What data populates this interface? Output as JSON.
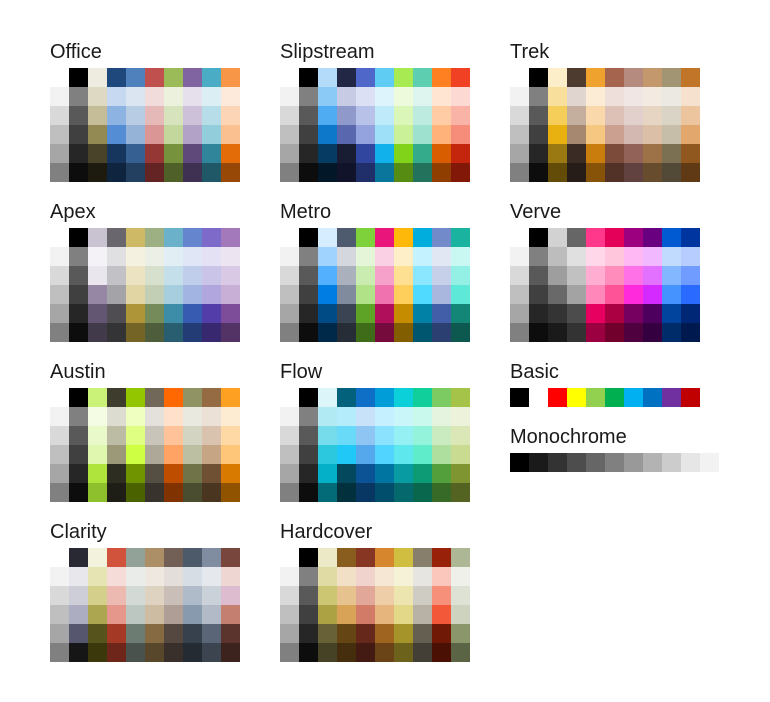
{
  "columns": [
    {
      "palettes": [
        {
          "name": "Office",
          "rows": [
            [
              "#ffffff",
              "#000000",
              "#eeece1",
              "#1f497d",
              "#4f81bd",
              "#c0504d",
              "#9bbb59",
              "#8064a2",
              "#4bacc6",
              "#f79646"
            ],
            [
              "#f2f2f2",
              "#808080",
              "#ddd9c3",
              "#c6d9f0",
              "#dbe5f1",
              "#f2dcdb",
              "#ebf1dd",
              "#e5e0ec",
              "#dbeef3",
              "#fdeada"
            ],
            [
              "#d9d9d9",
              "#595959",
              "#c4bd97",
              "#8db3e2",
              "#b8cce4",
              "#e5b9b7",
              "#d7e3bc",
              "#ccc1d9",
              "#b7dde8",
              "#fbd5b5"
            ],
            [
              "#bfbfbf",
              "#404040",
              "#938953",
              "#548dd4",
              "#95b3d7",
              "#d99694",
              "#c3d69b",
              "#b2a2c7",
              "#92cddc",
              "#fac08f"
            ],
            [
              "#a6a6a6",
              "#262626",
              "#494429",
              "#17365d",
              "#366092",
              "#953734",
              "#76923c",
              "#5f497a",
              "#31859b",
              "#e36c09"
            ],
            [
              "#808080",
              "#0d0d0d",
              "#1d1b10",
              "#0f243e",
              "#244061",
              "#632423",
              "#4f6128",
              "#3f3151",
              "#205867",
              "#974806"
            ]
          ]
        },
        {
          "name": "Apex",
          "rows": [
            [
              "#ffffff",
              "#000000",
              "#c9c2d1",
              "#69676d",
              "#ceb966",
              "#9cb084",
              "#6bb1c9",
              "#6585cf",
              "#7e6bc9",
              "#a379bb"
            ],
            [
              "#f2f2f2",
              "#808080",
              "#f4f2f6",
              "#e0e0e2",
              "#f5f1e0",
              "#ebefe6",
              "#e1eff4",
              "#e0e6f5",
              "#e5e1f4",
              "#ece4f1"
            ],
            [
              "#d9d9d9",
              "#595959",
              "#e9e6ed",
              "#c2c1c5",
              "#ebe3c1",
              "#d7dfcd",
              "#c4dfe9",
              "#c1ceeb",
              "#cbc4e9",
              "#d9c9e4"
            ],
            [
              "#bfbfbf",
              "#404040",
              "#9688a5",
              "#a4a3a8",
              "#e1d5a3",
              "#c3cfb4",
              "#a6cedf",
              "#a2b5e2",
              "#b1a6de",
              "#c7afd6"
            ],
            [
              "#a6a6a6",
              "#262626",
              "#635672",
              "#4f4d52",
              "#ae9638",
              "#758c5a",
              "#3d8da9",
              "#365bb0",
              "#533da9",
              "#7d4d99"
            ],
            [
              "#808080",
              "#0d0d0d",
              "#413a4b",
              "#343336",
              "#746425",
              "#4e5d3c",
              "#285e70",
              "#243c75",
              "#372870",
              "#533366"
            ]
          ]
        },
        {
          "name": "Austin",
          "rows": [
            [
              "#ffffff",
              "#000000",
              "#caf278",
              "#3e3d2d",
              "#94c600",
              "#71685a",
              "#ff6700",
              "#909465",
              "#956b43",
              "#fea022"
            ],
            [
              "#f2f2f2",
              "#808080",
              "#f4fce4",
              "#dddcd0",
              "#efffc0",
              "#e4e1dc",
              "#ffe0cb",
              "#e9e9e0",
              "#ece1d6",
              "#feecd2"
            ],
            [
              "#d9d9d9",
              "#595959",
              "#eaf9c9",
              "#bcbba3",
              "#dfff82",
              "#c9c4ba",
              "#ffc299",
              "#d3d4c1",
              "#d9c3ae",
              "#fed9a6"
            ],
            [
              "#bfbfbf",
              "#404040",
              "#dff7ae",
              "#9b9977",
              "#ceff43",
              "#aea898",
              "#ffa365",
              "#bdbfa2",
              "#c6a585",
              "#fec679"
            ],
            [
              "#a6a6a6",
              "#262626",
              "#aee43c",
              "#2e2d21",
              "#6f9400",
              "#544e43",
              "#bf4d00",
              "#6f7347",
              "#6f5032",
              "#d97a00"
            ],
            [
              "#808080",
              "#0d0d0d",
              "#8ec02d",
              "#1f1e16",
              "#4a6300",
              "#38342d",
              "#803300",
              "#4a4d2f",
              "#4a3521",
              "#905300"
            ]
          ]
        },
        {
          "name": "Clarity",
          "rows": [
            [
              "#ffffff",
              "#292934",
              "#f3f2dc",
              "#d2533c",
              "#93a299",
              "#ad8f67",
              "#726056",
              "#4c5a6a",
              "#808da0",
              "#79463d"
            ],
            [
              "#f2f2f2",
              "#e7e7ec",
              "#e6e4b3",
              "#f6dcd8",
              "#e9ece9",
              "#eee8e0",
              "#e4dedb",
              "#d7dde4",
              "#e5e8ec",
              "#eed6d2"
            ],
            [
              "#d9d9d9",
              "#ceced9",
              "#d4d08c",
              "#edbab1",
              "#d3d9d5",
              "#ded2c1",
              "#c9beb8",
              "#b0bbc9",
              "#cbd1d8",
              "#debccf"
            ],
            [
              "#bfbfbf",
              "#adadc1",
              "#aca651",
              "#e4978a",
              "#bdc7c1",
              "#cdbba2",
              "#ae9e95",
              "#889aae",
              "#b2bac7",
              "#c57f71"
            ],
            [
              "#a6a6a6",
              "#56566e",
              "#56531d",
              "#a43925",
              "#6d7c73",
              "#866b42",
              "#554840",
              "#37414d",
              "#5a6678",
              "#5a342d"
            ],
            [
              "#808080",
              "#161616",
              "#3b390c",
              "#6d2619",
              "#49524d",
              "#59472c",
              "#39302b",
              "#242b33",
              "#3c4450",
              "#3c231e"
            ]
          ]
        }
      ]
    },
    {
      "palettes": [
        {
          "name": "Slipstream",
          "rows": [
            [
              "#ffffff",
              "#000000",
              "#b4dcfa",
              "#212745",
              "#4e67c8",
              "#5eccf3",
              "#a7ea52",
              "#5dceaf",
              "#ff8021",
              "#f14124"
            ],
            [
              "#f2f2f2",
              "#808080",
              "#8bc9f7",
              "#c7cce4",
              "#dbe0f4",
              "#def4fc",
              "#edfadc",
              "#def5ef",
              "#ffe5d2",
              "#fcd9d3"
            ],
            [
              "#d9d9d9",
              "#595959",
              "#4facf3",
              "#909aca",
              "#b8c2e9",
              "#beeafa",
              "#dbf6b9",
              "#bdebdf",
              "#ffcca6",
              "#f9b3a7"
            ],
            [
              "#bfbfbf",
              "#404040",
              "#0d78c9",
              "#5967af",
              "#94a3de",
              "#9ee0f7",
              "#cAf197",
              "#9ee1cf",
              "#ffb279",
              "#f68d7b"
            ],
            [
              "#a6a6a6",
              "#262626",
              "#063c64",
              "#181d33",
              "#31479f",
              "#11b2eb",
              "#81d319",
              "#34ac8b",
              "#d85c00",
              "#c3260c"
            ],
            [
              "#808080",
              "#0d0d0d",
              "#021828",
              "#10132a",
              "#202f6a",
              "#0b769c",
              "#568c11",
              "#22725c",
              "#903d00",
              "#821908"
            ]
          ]
        },
        {
          "name": "Metro",
          "rows": [
            [
              "#ffffff",
              "#000000",
              "#d6ecff",
              "#4e5b6f",
              "#7fd13b",
              "#ea157a",
              "#feb80a",
              "#00addc",
              "#738aca",
              "#1ab39f"
            ],
            [
              "#f2f2f2",
              "#808080",
              "#a1d3ff",
              "#d4d8de",
              "#e5f5d7",
              "#fad0e4",
              "#feefc8",
              "#c5f2ff",
              "#e2e7f4",
              "#c9f7f2"
            ],
            [
              "#d9d9d9",
              "#595959",
              "#52b0ff",
              "#aab1bd",
              "#cbecb0",
              "#f5a1c9",
              "#fee092",
              "#8be6ff",
              "#c6d0e9",
              "#94f0e5"
            ],
            [
              "#bfbfbf",
              "#404040",
              "#007de2",
              "#808b9d",
              "#b1e288",
              "#f072ae",
              "#fed05b",
              "#51daff",
              "#a9b7de",
              "#5ee8d8"
            ],
            [
              "#a6a6a6",
              "#262626",
              "#004a86",
              "#3a4453",
              "#5ea226",
              "#af0f5b",
              "#c58c00",
              "#0081a5",
              "#425ea9",
              "#138677"
            ],
            [
              "#808080",
              "#0d0d0d",
              "#002848",
              "#272d37",
              "#3f6c19",
              "#750a3d",
              "#835e00",
              "#00566e",
              "#2c3f71",
              "#0d594f"
            ]
          ]
        },
        {
          "name": "Flow",
          "rows": [
            [
              "#ffffff",
              "#000000",
              "#dbf5f9",
              "#04617b",
              "#0f6fc6",
              "#009dd9",
              "#0bd0d9",
              "#10cf9b",
              "#7cca62",
              "#a5c249"
            ],
            [
              "#f2f2f2",
              "#808080",
              "#b2eaf3",
              "#b4ecfc",
              "#c7e2f9",
              "#c5f0ff",
              "#c9f7f9",
              "#c9f9ed",
              "#e4f4df",
              "#edf3da"
            ],
            [
              "#d9d9d9",
              "#595959",
              "#76dceb",
              "#6adaf9",
              "#8ec5f3",
              "#8be2ff",
              "#94f0f3",
              "#93f3db",
              "#caeabf",
              "#dbe7b6"
            ],
            [
              "#bfbfbf",
              "#404040",
              "#2bc8de",
              "#20c8f7",
              "#56a8ed",
              "#51d4ff",
              "#5ee8ee",
              "#5eecca",
              "#afdf9f",
              "#c9db91"
            ],
            [
              "#a6a6a6",
              "#262626",
              "#04b0c7",
              "#03485c",
              "#0b5394",
              "#0075a2",
              "#089ca2",
              "#0c9b74",
              "#539f3b",
              "#7e9532"
            ],
            [
              "#808080",
              "#0d0d0d",
              "#036a78",
              "#02303d",
              "#083763",
              "#004e6c",
              "#05686c",
              "#08674d",
              "#376a27",
              "#546321"
            ]
          ]
        },
        {
          "name": "Hardcover",
          "rows": [
            [
              "#ffffff",
              "#000000",
              "#ece9c6",
              "#895d1d",
              "#873624",
              "#d6862d",
              "#d0be40",
              "#877f6c",
              "#972109",
              "#aeb795"
            ],
            [
              "#f2f2f2",
              "#808080",
              "#e0dba4",
              "#f2e0c6",
              "#f0d3cc",
              "#f6e6d4",
              "#f5f2d7",
              "#e7e5e1",
              "#fbc7bd",
              "#eef0e9"
            ],
            [
              "#d9d9d9",
              "#595959",
              "#ccc572",
              "#e6c28f",
              "#e1a799",
              "#eecea9",
              "#ece5b0",
              "#cfccc3",
              "#f7907b",
              "#dee2d4"
            ],
            [
              "#bfbfbf",
              "#404040",
              "#aca143",
              "#d9a357",
              "#d27b67",
              "#e6b57e",
              "#e2d888",
              "#b7b2a5",
              "#f35838",
              "#cdd3be"
            ],
            [
              "#a6a6a6",
              "#262626",
              "#686137",
              "#664515",
              "#65281b",
              "#a06421",
              "#a4942a",
              "#655f51",
              "#711907",
              "#8b976a"
            ],
            [
              "#808080",
              "#0d0d0d",
              "#464225",
              "#442e0e",
              "#431b12",
              "#6a4316",
              "#6d621c",
              "#433f36",
              "#4b1004",
              "#5c6446"
            ]
          ]
        }
      ]
    },
    {
      "palettes": [
        {
          "name": "Trek",
          "rows": [
            [
              "#ffffff",
              "#000000",
              "#fbeec9",
              "#4e3b30",
              "#f0a22e",
              "#a5644e",
              "#b58b80",
              "#c3986d",
              "#a19574",
              "#c17529"
            ],
            [
              "#f2f2f2",
              "#808080",
              "#f8e09c",
              "#e1d6cf",
              "#fcecd5",
              "#eedfda",
              "#f0e7e5",
              "#f3eae1",
              "#ece9e2",
              "#f5e1ce"
            ],
            [
              "#d9d9d9",
              "#595959",
              "#f4ce58",
              "#c4af9f",
              "#f9d9ab",
              "#ddc0b6",
              "#e1d0cb",
              "#e7d5c4",
              "#d9d4c6",
              "#ecc49e"
            ],
            [
              "#bfbfbf",
              "#404040",
              "#e8b110",
              "#a68870",
              "#f6c781",
              "#cca091",
              "#d2b8b1",
              "#dbc0a7",
              "#c6bea9",
              "#e2a76d"
            ],
            [
              "#a6a6a6",
              "#262626",
              "#9b7912",
              "#3a2c24",
              "#c97d0d",
              "#7c4b3a",
              "#926259",
              "#9c7246",
              "#7b7051",
              "#90571e"
            ],
            [
              "#808080",
              "#0d0d0d",
              "#624c07",
              "#271d18",
              "#865309",
              "#523227",
              "#614240",
              "#684c2e",
              "#524a36",
              "#603a14"
            ]
          ]
        },
        {
          "name": "Verve",
          "rows": [
            [
              "#ffffff",
              "#000000",
              "#d2d2d2",
              "#666666",
              "#ff388c",
              "#e40059",
              "#9c007f",
              "#68007f",
              "#005bd3",
              "#00349e"
            ],
            [
              "#f2f2f2",
              "#808080",
              "#bdbdbd",
              "#e0e0e0",
              "#ffd7e8",
              "#ffc6dc",
              "#ffb8f3",
              "#f1b8ff",
              "#c1dbff",
              "#b8cdff"
            ],
            [
              "#d9d9d9",
              "#595959",
              "#9e9e9e",
              "#c1c1c1",
              "#ffaed1",
              "#ff8cba",
              "#ff71e7",
              "#e371ff",
              "#83b7ff",
              "#719cff"
            ],
            [
              "#bfbfbf",
              "#404040",
              "#696969",
              "#a3a3a3",
              "#ff87ba",
              "#ff5397",
              "#ff2adb",
              "#d52aff",
              "#4593ff",
              "#2a6aff"
            ],
            [
              "#a6a6a6",
              "#262626",
              "#343434",
              "#4c4c4c",
              "#e80061",
              "#ab0042",
              "#75005f",
              "#4e005f",
              "#00449e",
              "#002776"
            ],
            [
              "#808080",
              "#0d0d0d",
              "#1a1a1a",
              "#333333",
              "#9b0041",
              "#72002c",
              "#4e003f",
              "#34003f",
              "#002d69",
              "#001a4f"
            ]
          ]
        },
        {
          "name": "Basic",
          "rows": [
            [
              "#000000",
              "#ffffff",
              "#ff0000",
              "#ffff00",
              "#92d050",
              "#00b050",
              "#00b0f0",
              "#0070c0",
              "#7030a0",
              "#c00000"
            ]
          ]
        },
        {
          "name": "Monochrome",
          "rows": [
            [
              "#000000",
              "#1a1a1a",
              "#333333",
              "#4d4d4d",
              "#666666",
              "#808080",
              "#999999",
              "#b3b3b3",
              "#cccccc",
              "#e6e6e6",
              "#f2f2f2",
              "#ffffff"
            ]
          ]
        }
      ]
    }
  ]
}
